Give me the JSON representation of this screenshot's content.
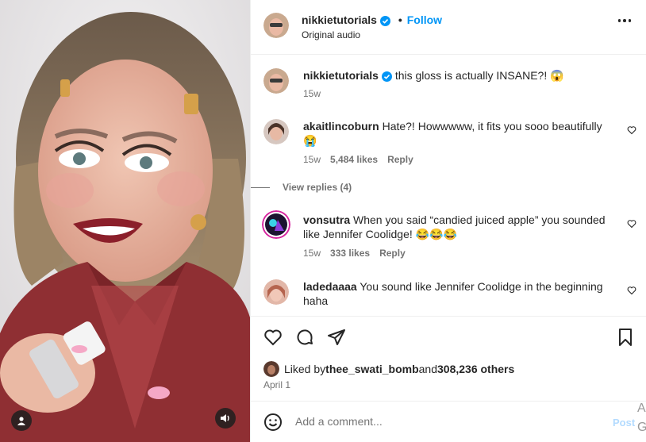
{
  "header": {
    "username": "nikkietutorials",
    "dot": "•",
    "follow_label": "Follow",
    "subtitle": "Original audio"
  },
  "caption": {
    "username": "nikkietutorials",
    "text": "this gloss is actually INSANE?! 😱",
    "time": "15w"
  },
  "comments": [
    {
      "username": "akaitlincoburn",
      "text": "Hate?! Howwwww, it fits you sooo beautifully 😭",
      "time": "15w",
      "likes": "5,484 likes",
      "reply": "Reply",
      "view_replies": "View replies (4)"
    },
    {
      "username": "vonsutra",
      "text": "When you said “candied juiced apple” you sounded like Jennifer Coolidge! 😂😂😂",
      "time": "15w",
      "likes": "333 likes",
      "reply": "Reply"
    },
    {
      "username": "ladedaaaa",
      "text": "You sound like Jennifer Coolidge in the beginning haha"
    }
  ],
  "likes": {
    "prefix": "Liked by ",
    "user": "thee_swati_bomb",
    "middle": " and ",
    "count": "308,236 others"
  },
  "date": "April 1",
  "add_comment": {
    "placeholder": "Add a comment...",
    "post_label": "Post"
  },
  "edge_text": [
    "A",
    "G"
  ],
  "colors": {
    "link": "#0095f6",
    "muted": "#737373",
    "post_disabled": "#b3dbff"
  }
}
